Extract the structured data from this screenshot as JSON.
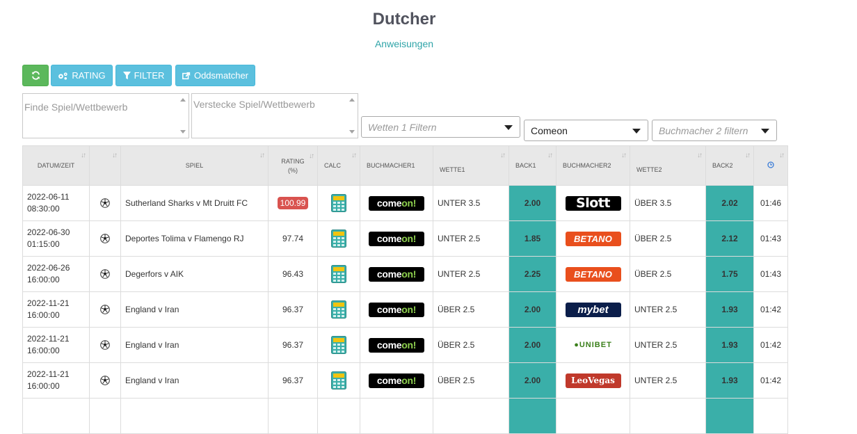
{
  "header": {
    "title": "Dutcher",
    "link": "Anweisungen"
  },
  "toolbar": {
    "refresh_icon": "refresh-icon",
    "rating_label": "RATING",
    "filter_label": "FILTER",
    "oddsmatcher_label": "Oddsmatcher"
  },
  "filters": {
    "find_placeholder": "Finde Spiel/Wettbewerb",
    "hide_placeholder": "Verstecke Spiel/Wettbewerb",
    "bets_placeholder": "Wetten 1 Filtern",
    "bookmaker1_value": "Comeon",
    "bookmaker2_placeholder": "Buchmacher 2 filtern"
  },
  "colors": {
    "accent": "#3aafa9",
    "rating_badge": "#d9534f",
    "refresh_button": "#5cb85c",
    "tool_button": "#5bc0de"
  },
  "table": {
    "headers": {
      "datum": "DATUM/ZEIT",
      "spiel": "SPIEL",
      "rating": "RATING",
      "rating_unit": "(%)",
      "calc": "CALC",
      "buchmacher1": "BUCHMACHER1",
      "wette1": "WETTE1",
      "back1": "BACK1",
      "buchmacher2": "BUCHMACHER2",
      "wette2": "WETTE2",
      "back2": "BACK2",
      "time_icon": "clock-icon"
    },
    "rows": [
      {
        "date": "2022-06-11",
        "time": "08:30:00",
        "match": "Sutherland Sharks v Mt Druitt FC",
        "rating": "100.99",
        "bookie1": "comeon",
        "bet1": "UNTER 3.5",
        "back1": "2.00",
        "bookie2": "slott",
        "bet2": "ÜBER 3.5",
        "back2": "2.02",
        "age": "01:46"
      },
      {
        "date": "2022-06-30",
        "time": "01:15:00",
        "match": "Deportes Tolima v Flamengo RJ",
        "rating": "97.74",
        "bookie1": "comeon",
        "bet1": "UNTER 2.5",
        "back1": "1.85",
        "bookie2": "betano",
        "bet2": "ÜBER 2.5",
        "back2": "2.12",
        "age": "01:43"
      },
      {
        "date": "2022-06-26",
        "time": "16:00:00",
        "match": "Degerfors v AIK",
        "rating": "96.43",
        "bookie1": "comeon",
        "bet1": "UNTER 2.5",
        "back1": "2.25",
        "bookie2": "betano",
        "bet2": "ÜBER 2.5",
        "back2": "1.75",
        "age": "01:43"
      },
      {
        "date": "2022-11-21",
        "time": "16:00:00",
        "match": "England v Iran",
        "rating": "96.37",
        "bookie1": "comeon",
        "bet1": "ÜBER 2.5",
        "back1": "2.00",
        "bookie2": "mybet",
        "bet2": "UNTER 2.5",
        "back2": "1.93",
        "age": "01:42"
      },
      {
        "date": "2022-11-21",
        "time": "16:00:00",
        "match": "England v Iran",
        "rating": "96.37",
        "bookie1": "comeon",
        "bet1": "ÜBER 2.5",
        "back1": "2.00",
        "bookie2": "unibet",
        "bet2": "UNTER 2.5",
        "back2": "1.93",
        "age": "01:42"
      },
      {
        "date": "2022-11-21",
        "time": "16:00:00",
        "match": "England v Iran",
        "rating": "96.37",
        "bookie1": "comeon",
        "bet1": "ÜBER 2.5",
        "back1": "2.00",
        "bookie2": "leovegas",
        "bet2": "UNTER 2.5",
        "back2": "1.93",
        "age": "01:42"
      }
    ]
  }
}
